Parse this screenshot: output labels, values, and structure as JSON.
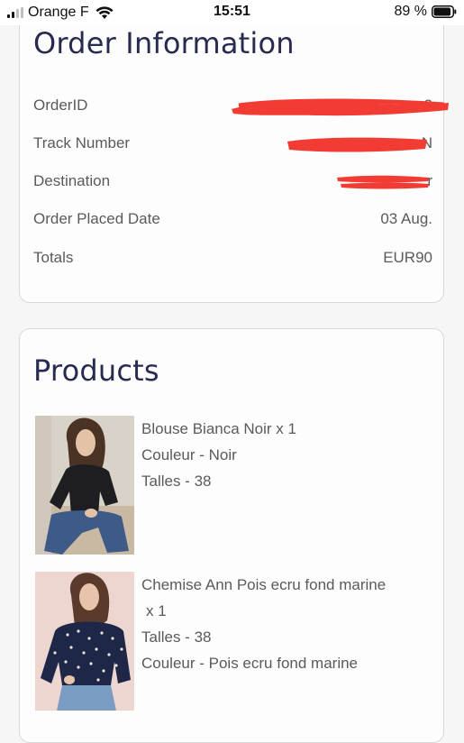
{
  "status_bar": {
    "carrier": "Orange F",
    "time": "15:51",
    "battery": "89 %"
  },
  "order": {
    "title": "Order Information",
    "rows": [
      {
        "label": "OrderID",
        "value": "2"
      },
      {
        "label": "Track Number",
        "value": "N"
      },
      {
        "label": "Destination",
        "value": "r"
      },
      {
        "label": "Order Placed Date",
        "value": "03 Aug."
      },
      {
        "label": "Totals",
        "value": "EUR90"
      }
    ]
  },
  "products": {
    "title": "Products",
    "items": [
      {
        "name": "Blouse Bianca Noir x 1",
        "details": [
          "Couleur - Noir",
          "Talles - 38"
        ]
      },
      {
        "name": "Chemise Ann Pois ecru fond marine",
        "quantity": "x 1",
        "details": [
          "Talles - 38",
          "Couleur - Pois ecru fond marine"
        ]
      }
    ]
  },
  "colors": {
    "heading": "#262b4f",
    "text": "#5a5a5a",
    "redaction": "#f23c33",
    "card_border": "#d9d7d7"
  }
}
